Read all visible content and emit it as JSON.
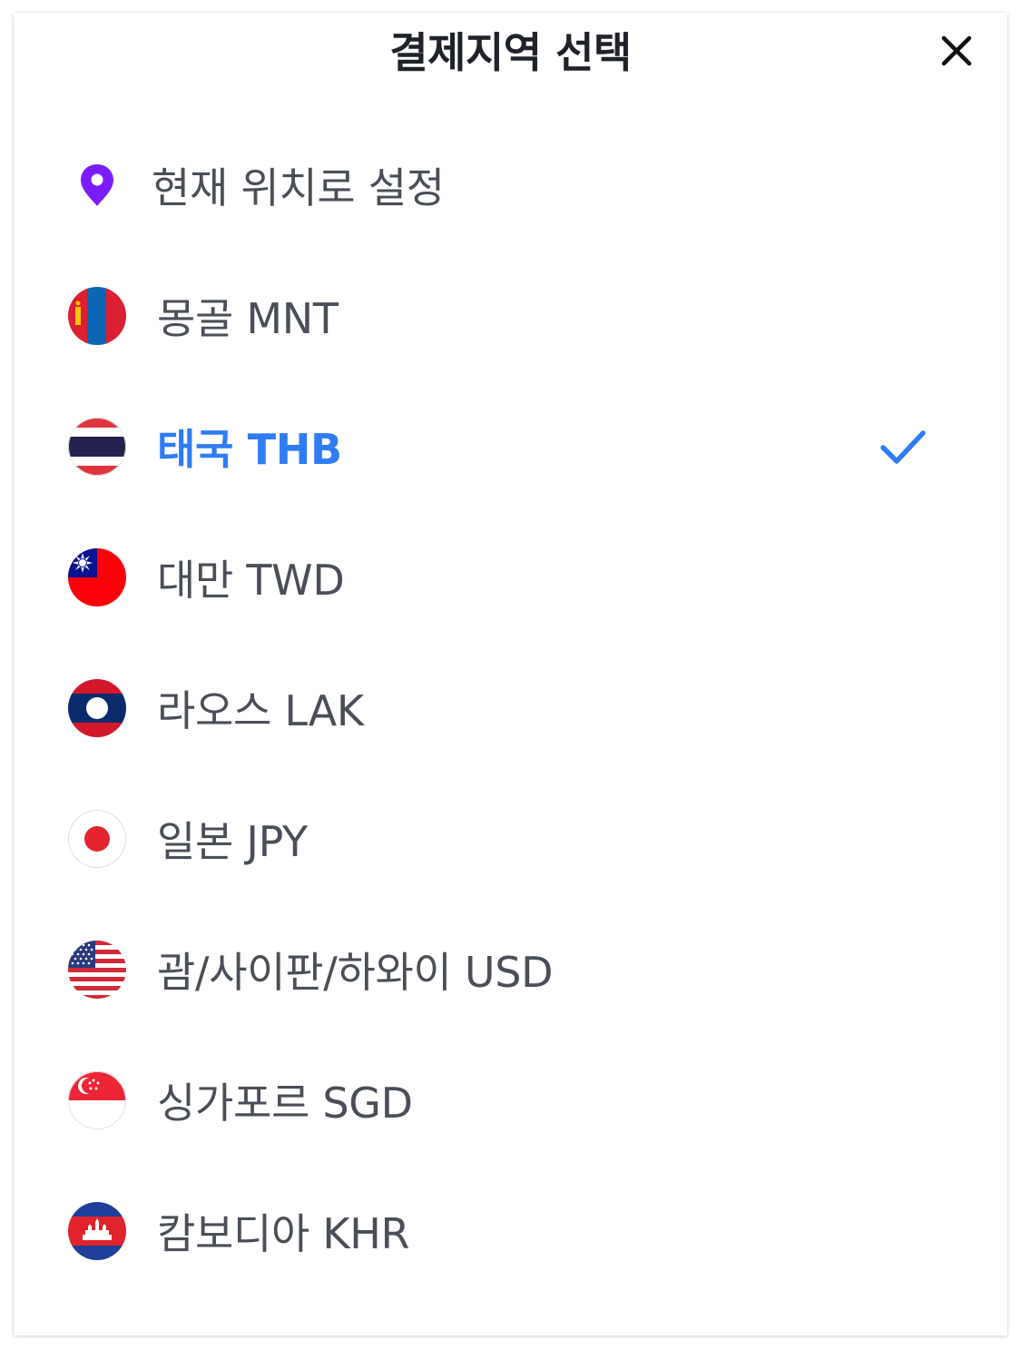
{
  "header": {
    "title": "결제지역 선택",
    "close_icon": "close-icon"
  },
  "current_location": {
    "label": "현재 위치로 설정",
    "icon": "location-pin-icon",
    "icon_color": "#7b1cff"
  },
  "regions": [
    {
      "id": "mongolia",
      "label": "몽골 MNT",
      "flag_icon": "mongolia-flag-icon",
      "selected": false
    },
    {
      "id": "thailand",
      "label": "태국 THB",
      "flag_icon": "thailand-flag-icon",
      "selected": true
    },
    {
      "id": "taiwan",
      "label": "대만 TWD",
      "flag_icon": "taiwan-flag-icon",
      "selected": false
    },
    {
      "id": "laos",
      "label": "라오스 LAK",
      "flag_icon": "laos-flag-icon",
      "selected": false
    },
    {
      "id": "japan",
      "label": "일본 JPY",
      "flag_icon": "japan-flag-icon",
      "selected": false
    },
    {
      "id": "usa",
      "label": "괌/사이판/하와이 USD",
      "flag_icon": "usa-flag-icon",
      "selected": false
    },
    {
      "id": "singapore",
      "label": "싱가포르 SGD",
      "flag_icon": "singapore-flag-icon",
      "selected": false
    },
    {
      "id": "cambodia",
      "label": "캄보디아 KHR",
      "flag_icon": "cambodia-flag-icon",
      "selected": false
    }
  ],
  "colors": {
    "selected_text": "#2f7cf6",
    "default_text": "#4a4f57",
    "title_text": "#1f2329",
    "check": "#2f7cf6"
  },
  "selected_indicator_icon": "checkmark-icon"
}
